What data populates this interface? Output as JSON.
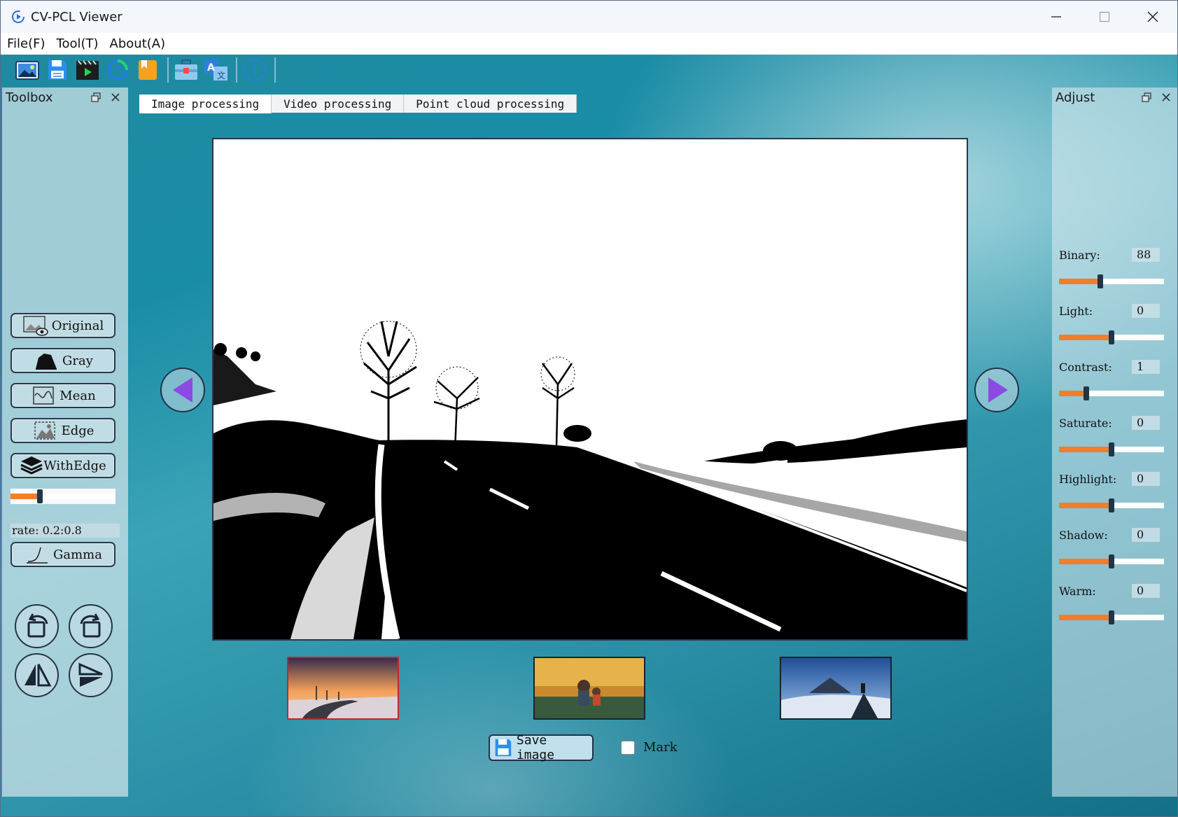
{
  "window": {
    "title": "CV-PCL Viewer"
  },
  "menu": {
    "items": [
      "File(F)",
      "Tool(T)",
      "About(A)"
    ]
  },
  "toolbar": {
    "buttons": [
      "open-image-icon",
      "save-icon",
      "video-icon",
      "refresh-icon",
      "bookmark-icon",
      "toolbox-icon",
      "translate-icon",
      "info-icon"
    ]
  },
  "toolbox": {
    "title": "Toolbox",
    "buttons": {
      "original": "Original",
      "gray": "Gray",
      "mean": "Mean",
      "edge": "Edge",
      "withedge": "WithEdge",
      "gamma": "Gamma"
    },
    "rate_label": "rate: 0.2:0.8",
    "rate_slider_fraction": 0.28
  },
  "tabs": [
    "Image processing",
    "Video processing",
    "Point cloud processing"
  ],
  "active_tab": "Image processing",
  "viewer": {
    "save_label": "Save image",
    "mark_label": "Mark",
    "mark_checked": false,
    "selected_thumbnail": 0
  },
  "adjust": {
    "title": "Adjust",
    "controls": [
      {
        "label": "Binary:",
        "value": "88",
        "fraction": 0.39
      },
      {
        "label": "Light:",
        "value": "0",
        "fraction": 0.5
      },
      {
        "label": "Contrast:",
        "value": "1",
        "fraction": 0.26
      },
      {
        "label": "Saturate:",
        "value": "0",
        "fraction": 0.5
      },
      {
        "label": "Highlight:",
        "value": "0",
        "fraction": 0.5
      },
      {
        "label": "Shadow:",
        "value": "0",
        "fraction": 0.5
      },
      {
        "label": "Warm:",
        "value": "0",
        "fraction": 0.5
      }
    ]
  },
  "colors": {
    "accent_orange": "#f07e2d",
    "nav_arrow": "#8b4be3",
    "background_teal": "#1f8aa0"
  }
}
